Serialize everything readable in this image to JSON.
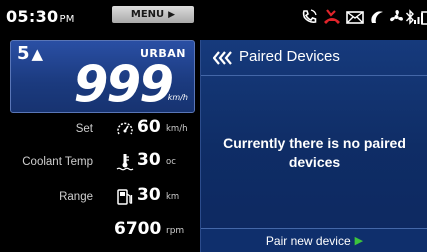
{
  "status": {
    "time": "05:30",
    "ampm": "PM",
    "menu_label": "MENU",
    "icons": [
      "call-icon",
      "missed-call-icon",
      "message-icon",
      "music-icon",
      "fan-icon",
      "bluetooth-icon",
      "signal-icon",
      "battery-icon"
    ],
    "missed_call_color": "#e0242b"
  },
  "speed_panel": {
    "gear": "5",
    "mode": "URBAN",
    "speed": "999",
    "unit": "km/h"
  },
  "readouts": [
    {
      "label": "Set",
      "value": "60",
      "unit": "km/h",
      "icon": "cruise-speedometer-icon"
    },
    {
      "label": "Coolant Temp",
      "value": "30",
      "unit": "oc",
      "icon": "coolant-thermometer-icon"
    },
    {
      "label": "Range",
      "value": "30",
      "unit": "km",
      "icon": "fuel-pump-icon"
    }
  ],
  "rpm": {
    "value": "6700",
    "unit": "rpm"
  },
  "devices": {
    "title": "Paired Devices",
    "empty_message": "Currently there is no paired devices",
    "pair_button": "Pair new device"
  },
  "colors": {
    "panel_blue": "#1b3a7e",
    "accent_green": "#3cc43c"
  }
}
